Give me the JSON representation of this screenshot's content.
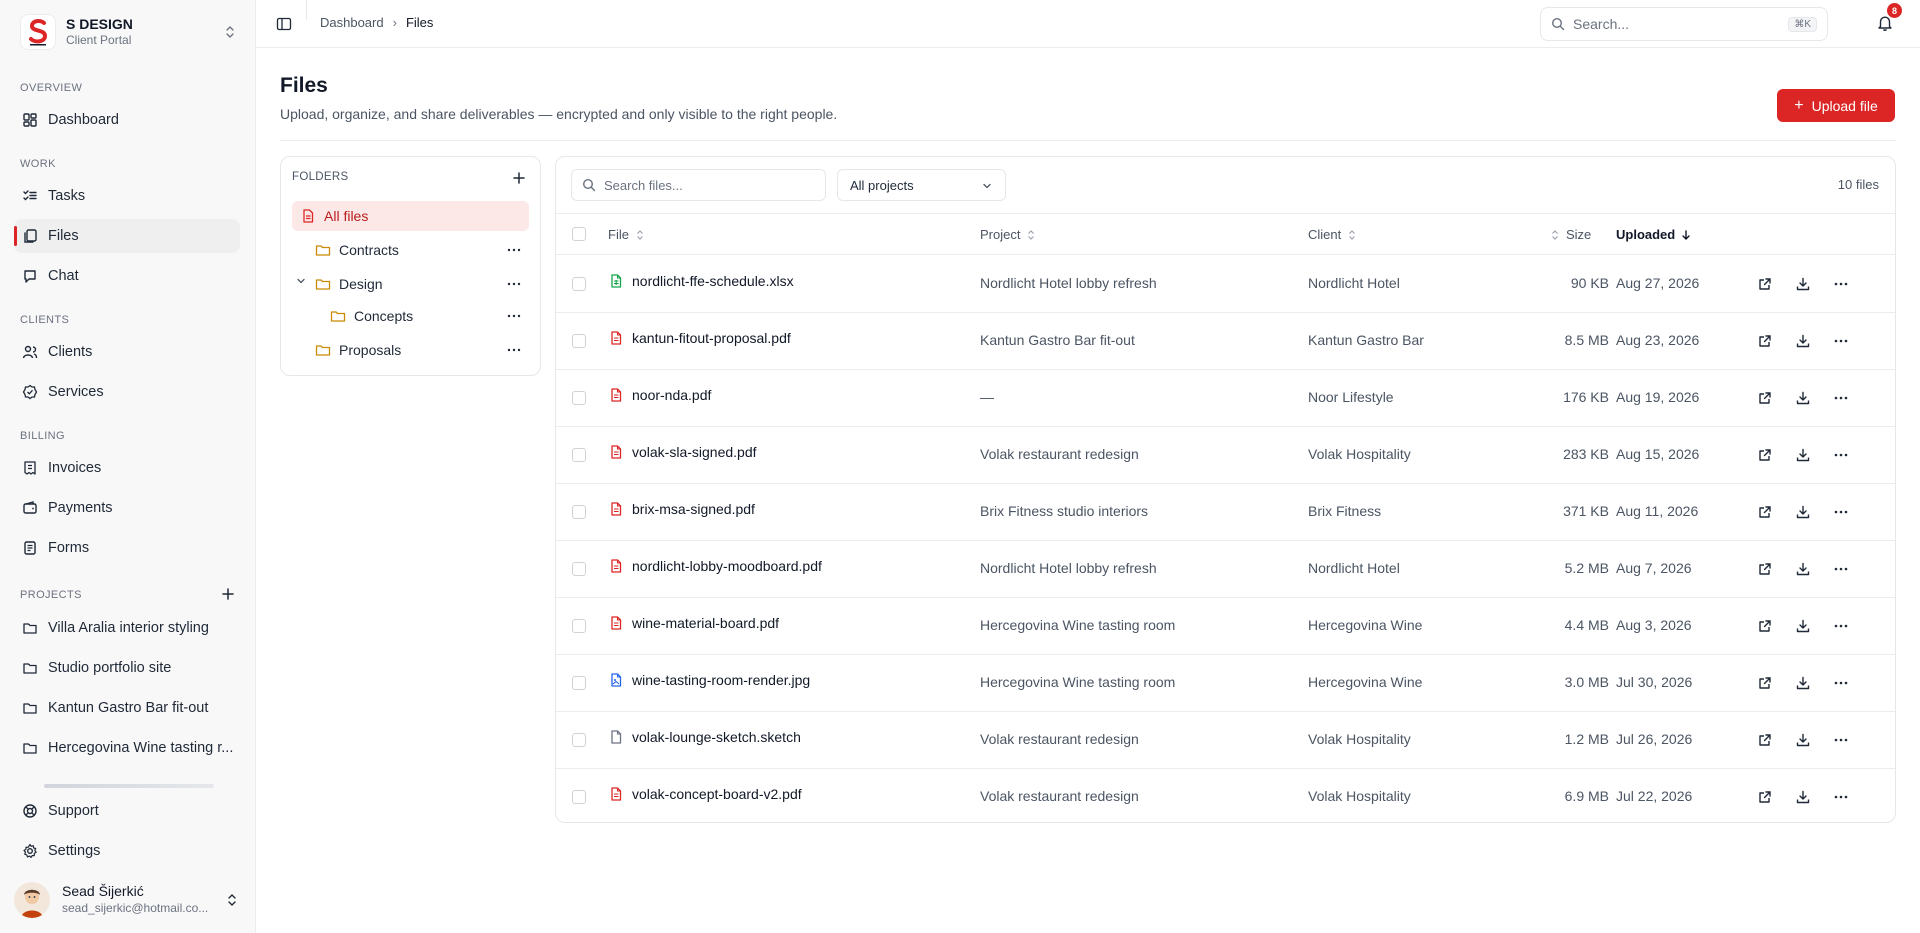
{
  "brand": {
    "name": "S DESIGN",
    "subtitle": "Client Portal",
    "logo_letter": "S"
  },
  "sidebar": {
    "sections": {
      "overview": "OVERVIEW",
      "work": "WORK",
      "clients": "CLIENTS",
      "billing": "BILLING",
      "projects": "PROJECTS"
    },
    "items": {
      "dashboard": "Dashboard",
      "tasks": "Tasks",
      "files": "Files",
      "chat": "Chat",
      "clients": "Clients",
      "services": "Services",
      "invoices": "Invoices",
      "payments": "Payments",
      "forms": "Forms",
      "support": "Support",
      "settings": "Settings"
    },
    "active_item": "Files",
    "projects": [
      "Villa Aralia interior styling",
      "Studio portfolio site",
      "Kantun Gastro Bar fit-out",
      "Hercegovina Wine tasting r..."
    ],
    "user": {
      "name": "Sead Šijerkić",
      "email": "sead_sijerkic@hotmail.co..."
    }
  },
  "topbar": {
    "breadcrumb": [
      "Dashboard",
      "Files"
    ],
    "search_placeholder": "Search...",
    "search_shortcut": "⌘K",
    "notification_count": "8"
  },
  "page": {
    "title": "Files",
    "subtitle": "Upload, organize, and share deliverables — encrypted and only visible to the right people.",
    "upload_label": "Upload file"
  },
  "folders": {
    "header": "FOLDERS",
    "items": [
      {
        "name": "All files",
        "selected": true
      },
      {
        "name": "Contracts"
      },
      {
        "name": "Design",
        "expanded": true
      },
      {
        "name": "Concepts",
        "parent": "Design"
      },
      {
        "name": "Proposals"
      }
    ]
  },
  "files": {
    "search_placeholder": "Search files...",
    "project_filter": "All projects",
    "count_label": "10 files",
    "columns": [
      "File",
      "Project",
      "Client",
      "Size",
      "Uploaded"
    ],
    "sorted_column": "Uploaded",
    "rows": [
      {
        "name": "nordlicht-ffe-schedule.xlsx",
        "type": "sheet",
        "project": "Nordlicht Hotel lobby refresh",
        "client": "Nordlicht Hotel",
        "size": "90 KB",
        "uploaded": "Aug 27, 2026"
      },
      {
        "name": "kantun-fitout-proposal.pdf",
        "type": "pdf",
        "project": "Kantun Gastro Bar fit-out",
        "client": "Kantun Gastro Bar",
        "size": "8.5 MB",
        "uploaded": "Aug 23, 2026"
      },
      {
        "name": "noor-nda.pdf",
        "type": "pdf",
        "project": "—",
        "client": "Noor Lifestyle",
        "size": "176 KB",
        "uploaded": "Aug 19, 2026"
      },
      {
        "name": "volak-sla-signed.pdf",
        "type": "pdf",
        "project": "Volak restaurant redesign",
        "client": "Volak Hospitality",
        "size": "283 KB",
        "uploaded": "Aug 15, 2026"
      },
      {
        "name": "brix-msa-signed.pdf",
        "type": "pdf",
        "project": "Brix Fitness studio interiors",
        "client": "Brix Fitness",
        "size": "371 KB",
        "uploaded": "Aug 11, 2026"
      },
      {
        "name": "nordlicht-lobby-moodboard.pdf",
        "type": "pdf",
        "project": "Nordlicht Hotel lobby refresh",
        "client": "Nordlicht Hotel",
        "size": "5.2 MB",
        "uploaded": "Aug 7, 2026"
      },
      {
        "name": "wine-material-board.pdf",
        "type": "pdf",
        "project": "Hercegovina Wine tasting room",
        "client": "Hercegovina Wine",
        "size": "4.4 MB",
        "uploaded": "Aug 3, 2026"
      },
      {
        "name": "wine-tasting-room-render.jpg",
        "type": "image",
        "project": "Hercegovina Wine tasting room",
        "client": "Hercegovina Wine",
        "size": "3.0 MB",
        "uploaded": "Jul 30, 2026"
      },
      {
        "name": "volak-lounge-sketch.sketch",
        "type": "generic",
        "project": "Volak restaurant redesign",
        "client": "Volak Hospitality",
        "size": "1.2 MB",
        "uploaded": "Jul 26, 2026"
      },
      {
        "name": "volak-concept-board-v2.pdf",
        "type": "pdf",
        "project": "Volak restaurant redesign",
        "client": "Volak Hospitality",
        "size": "6.9 MB",
        "uploaded": "Jul 22, 2026"
      }
    ]
  },
  "colors": {
    "accent": "#dc2626",
    "selected_bg": "#fde8e8",
    "pdf_icon": "#dc2626",
    "sheet_icon": "#16a34a",
    "image_icon": "#2563eb",
    "folder_icon": "#ca8a04"
  },
  "icons": {
    "dashboard": "grid-icon",
    "tasks": "checklist-icon",
    "files": "files-icon",
    "chat": "chat-icon",
    "clients": "users-icon",
    "services": "badge-icon",
    "invoices": "receipt-icon",
    "payments": "wallet-icon",
    "forms": "form-icon",
    "support": "lifebuoy-icon",
    "settings": "gear-icon",
    "project": "folder-icon"
  }
}
